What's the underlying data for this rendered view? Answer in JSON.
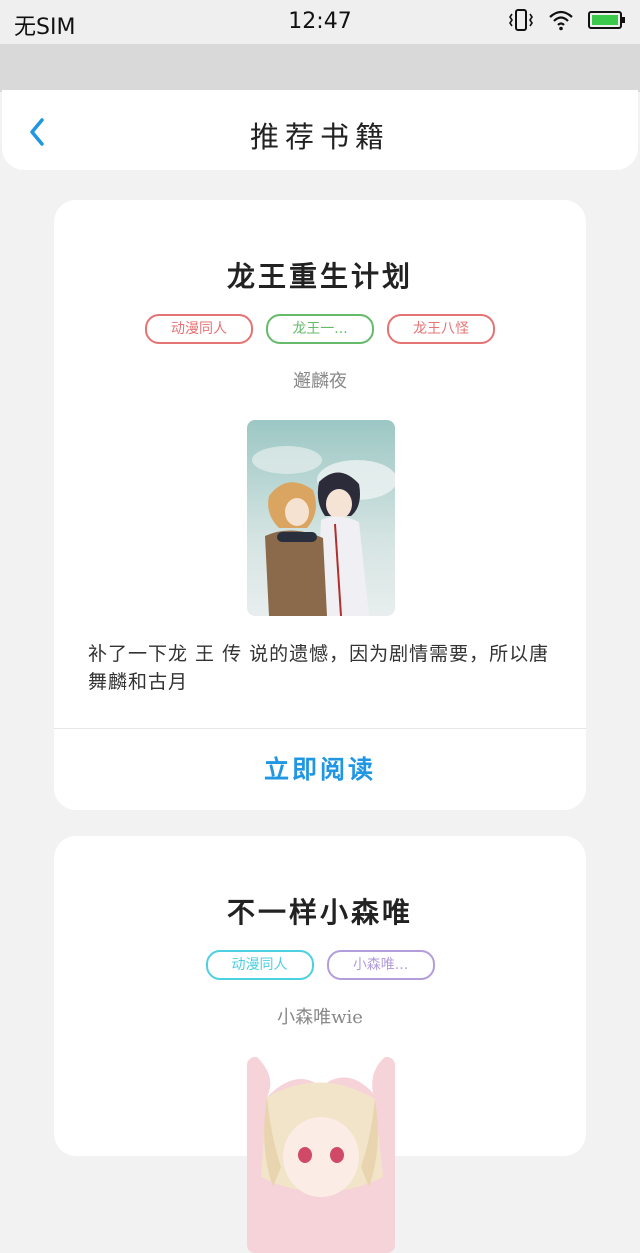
{
  "status": {
    "carrier": "无SIM",
    "time": "12:47"
  },
  "header": {
    "title": "推荐书籍"
  },
  "books": [
    {
      "title": "龙王重生计划",
      "tags": [
        {
          "label": "动漫同人",
          "color": "#e57373"
        },
        {
          "label": "龙王一...",
          "color": "#66bb6a"
        },
        {
          "label": "龙王八怪",
          "color": "#e57373"
        }
      ],
      "author": "邂麟夜",
      "summary": "补了一下龙 王 传 说的遗憾，因为剧情需要，所以唐舞麟和古月",
      "read_label": "立即阅读"
    },
    {
      "title": "不一样小森唯",
      "tags": [
        {
          "label": "动漫同人",
          "color": "#4dd0e1"
        },
        {
          "label": "小森唯...",
          "color": "#b39ddb"
        }
      ],
      "author": "小森唯wie"
    }
  ],
  "colors": {
    "accent": "#2196e3",
    "battery": "#3cc84a"
  }
}
